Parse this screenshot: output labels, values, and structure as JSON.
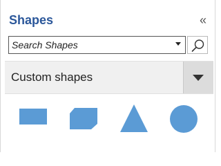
{
  "panel": {
    "title": "Shapes",
    "collapse_icon": "chevron-double-left-icon"
  },
  "search": {
    "placeholder": "Search Shapes",
    "value": "",
    "dropdown_icon": "caret-down-icon",
    "button_icon": "search-icon"
  },
  "category": {
    "label": "Custom shapes",
    "toggle_icon": "caret-down-icon"
  },
  "shapes": [
    {
      "name": "rectangle",
      "color": "#5b9bd5"
    },
    {
      "name": "snipped-rectangle",
      "color": "#5b9bd5"
    },
    {
      "name": "triangle",
      "color": "#5b9bd5"
    },
    {
      "name": "circle",
      "color": "#5b9bd5"
    }
  ],
  "colors": {
    "title": "#2b579a",
    "shape_fill": "#5b9bd5",
    "category_bg": "#f0f0f0",
    "toggle_bg": "#dcdcdc"
  }
}
